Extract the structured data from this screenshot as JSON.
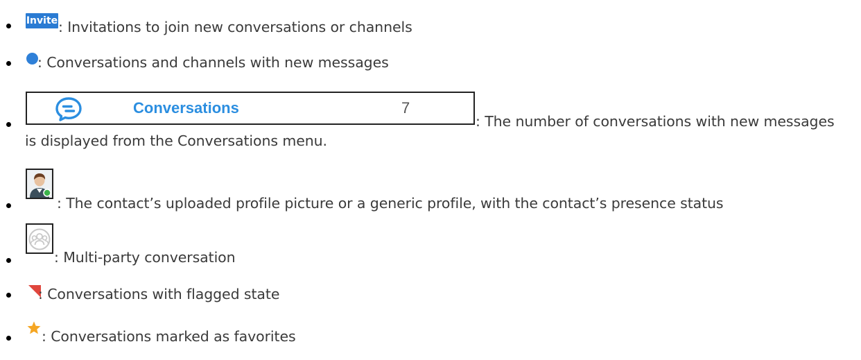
{
  "items": [
    {
      "icon": "invite-badge",
      "badge_text": "Invite",
      "text": ": Invitations to join new conversations or channels"
    },
    {
      "icon": "blue-dot-icon",
      "text": ": Conversations and channels with new messages"
    },
    {
      "icon": "conversations-menu-item",
      "menu_label": "Conversations",
      "menu_count": "7",
      "text": ": The number of conversations with new messages",
      "text_continued": "is displayed from the Conversations menu."
    },
    {
      "icon": "contact-avatar-icon",
      "text": ": The contact’s uploaded profile picture or a generic profile, with the contact’s presence status"
    },
    {
      "icon": "multi-party-avatar-icon",
      "text": ": Multi-party conversation"
    },
    {
      "icon": "flag-icon",
      "text": ": Conversations with flagged state"
    },
    {
      "icon": "star-icon",
      "text": ": Conversations marked as favorites"
    }
  ],
  "colors": {
    "invite_badge": "#2a7bd3",
    "unread_dot": "#2f80d8",
    "menu_label": "#2b8ee0",
    "flag": "#e0463d",
    "star": "#f5a623",
    "presence_available": "#3cb44b"
  }
}
